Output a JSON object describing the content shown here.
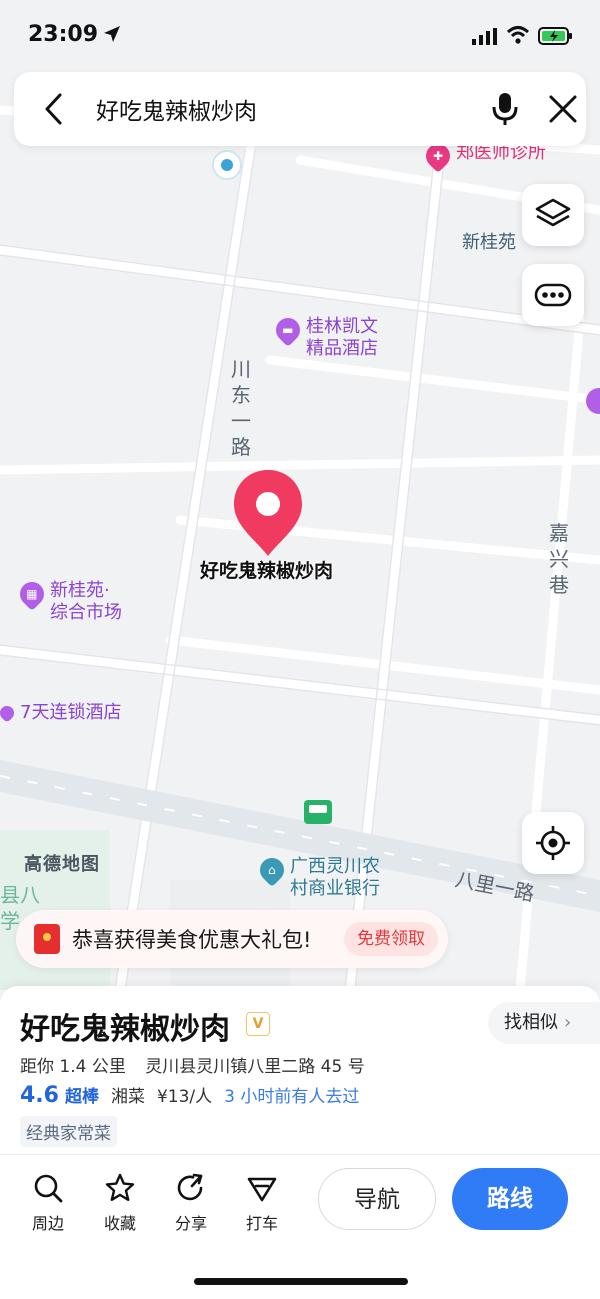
{
  "status_bar": {
    "time": "23:09"
  },
  "search": {
    "query": "好吃鬼辣椒炒肉"
  },
  "map": {
    "pois": [
      {
        "name_lines": [
          "郑医师诊所"
        ]
      },
      {
        "name_lines": [
          "新桂苑"
        ]
      },
      {
        "name_lines": [
          "桂林凯文",
          "精品酒店"
        ]
      },
      {
        "name_lines": [
          "新桂苑·",
          "综合市场"
        ]
      },
      {
        "name_lines": [
          "7天连锁酒店"
        ]
      },
      {
        "name_lines": [
          "广西灵川农",
          "村商业银行"
        ]
      }
    ],
    "roads": {
      "chuandong": [
        "川",
        "东",
        "一",
        "路"
      ],
      "jiaxing": [
        "嘉",
        "兴",
        "巷"
      ],
      "bali": "八里一路"
    },
    "edge_labels": {
      "county": [
        "县八",
        "学"
      ]
    },
    "selected_marker_label": "好吃鬼辣椒炒肉",
    "brand": "高德地图"
  },
  "promo": {
    "text": "恭喜获得美食优惠大礼包!",
    "cta": "免费领取"
  },
  "place": {
    "name": "好吃鬼辣椒炒肉",
    "badge": "V",
    "find_similar": "找相似",
    "distance": "距你 1.4 公里",
    "address": "灵川县灵川镇八里二路 45 号",
    "rating": "4.6",
    "rating_text": "超棒",
    "cuisine": "湘菜",
    "price": "¥13/人",
    "recent_visit": "3 小时前有人去过",
    "tag": "经典家常菜"
  },
  "actions": {
    "nearby": "周边",
    "favorite": "收藏",
    "share": "分享",
    "taxi": "打车",
    "navigate": "导航",
    "route": "路线"
  },
  "colors": {
    "accent": "#2f7cf6",
    "pin": "#f03a5f",
    "poi_purple": "#8b43d1",
    "promo_red": "#e52e2e"
  }
}
